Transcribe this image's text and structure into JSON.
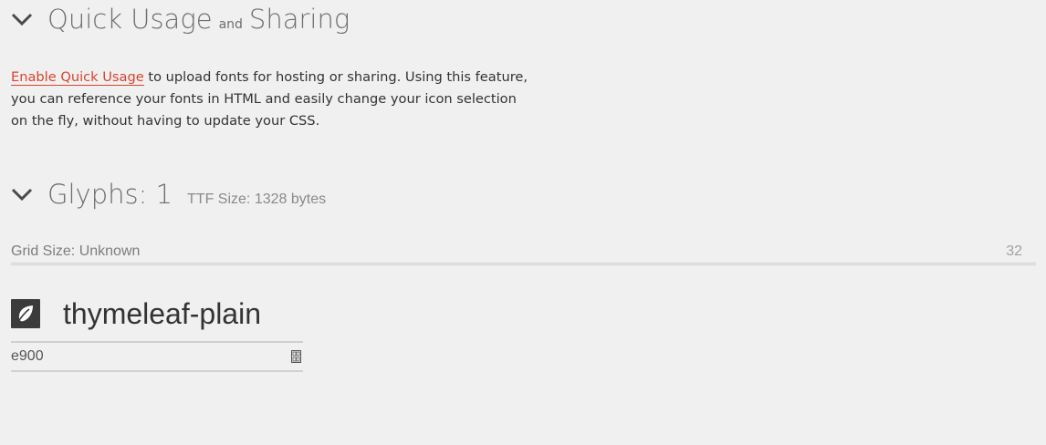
{
  "quick_usage": {
    "title_part1": "Quick Usage",
    "title_small": "and",
    "title_part2": "Sharing",
    "enable_link": "Enable Quick Usage",
    "description": " to upload fonts for hosting or sharing. Using this feature, you can reference your fonts in HTML and easily change your icon selection on the fly, without having to update your CSS."
  },
  "glyphs": {
    "title": "Glyphs: 1",
    "ttf_size": "TTF Size: 1328 bytes",
    "grid_label": "Grid Size: Unknown",
    "grid_value": "32",
    "items": [
      {
        "name": "thymeleaf-plain",
        "code": "e900",
        "icon": "leaf-icon"
      }
    ]
  },
  "colors": {
    "link": "#d9432f",
    "heading": "#6e6e6e",
    "icon_bg": "#3b3b3b",
    "background": "#f0f0f0"
  }
}
